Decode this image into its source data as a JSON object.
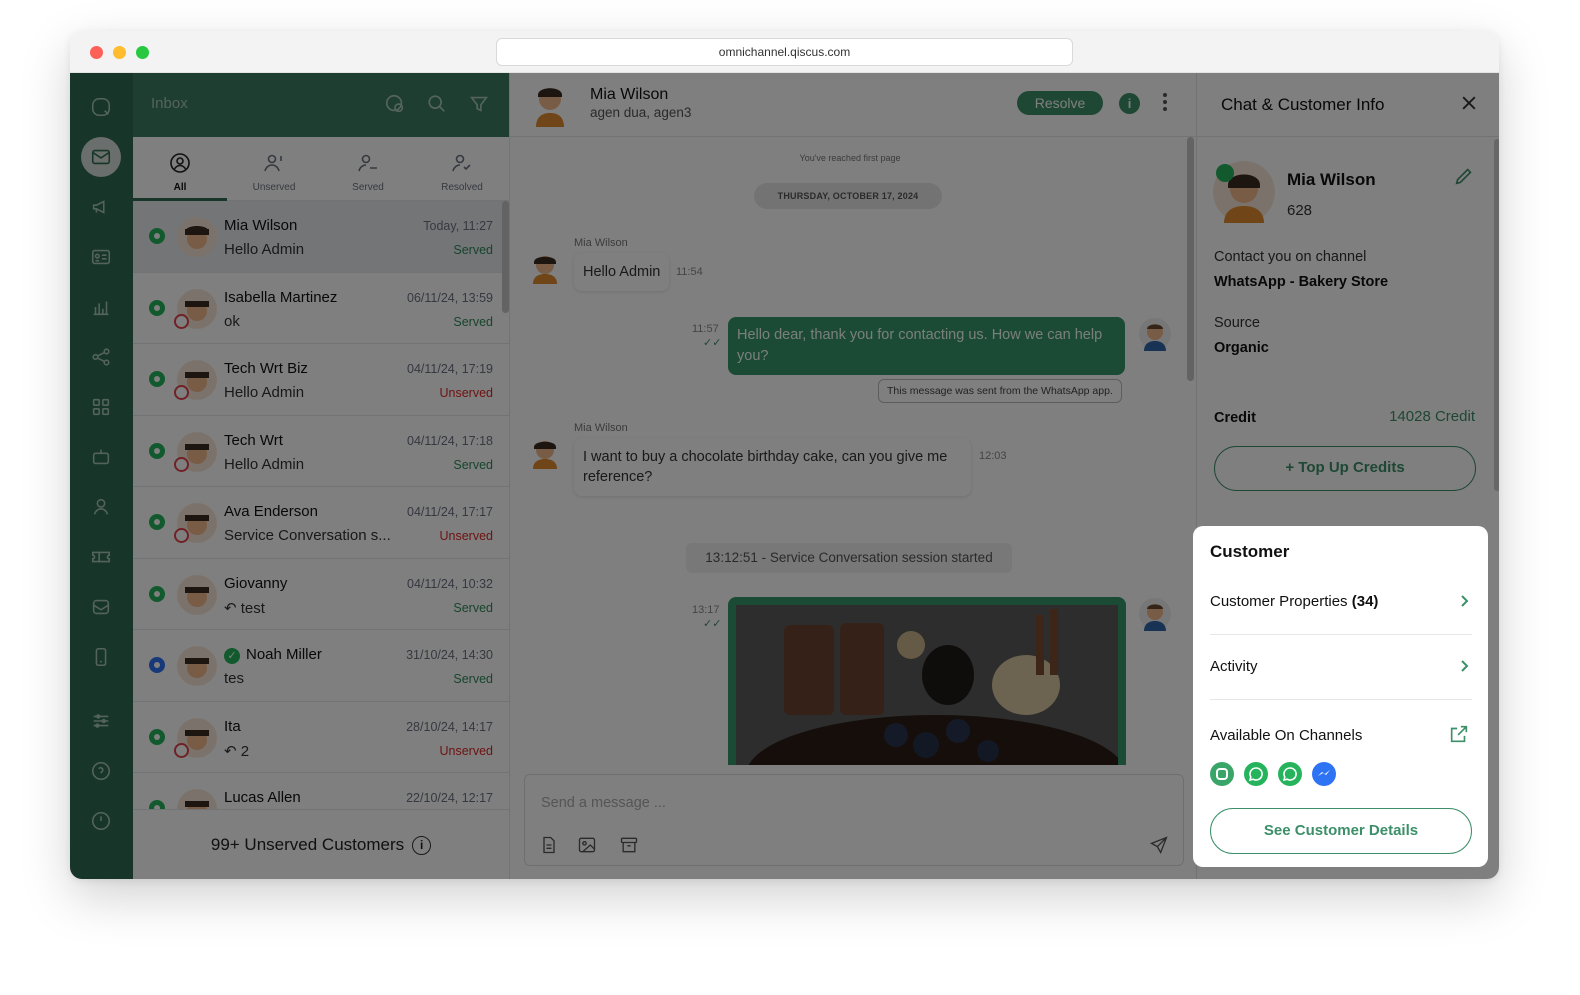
{
  "browser": {
    "url": "omnichannel.qiscus.com"
  },
  "inbox": {
    "title": "Inbox",
    "tabs": [
      {
        "label": "All"
      },
      {
        "label": "Unserved"
      },
      {
        "label": "Served"
      },
      {
        "label": "Resolved"
      }
    ],
    "rows": [
      {
        "name": "Mia Wilson",
        "message": "Hello Admin",
        "time": "Today, 11:27",
        "status": "Served",
        "channel": "whatsapp"
      },
      {
        "name": "Isabella Martinez",
        "message": "ok",
        "time": "06/11/24, 13:59",
        "status": "Served",
        "channel": "whatsapp"
      },
      {
        "name": "Tech Wrt Biz",
        "message": "Hello Admin",
        "time": "04/11/24, 17:19",
        "status": "Unserved",
        "channel": "whatsapp"
      },
      {
        "name": "Tech Wrt",
        "message": "Hello Admin",
        "time": "04/11/24, 17:18",
        "status": "Served",
        "channel": "whatsapp"
      },
      {
        "name": "Ava Enderson",
        "message": "Service Conversation s...",
        "time": "04/11/24, 17:17",
        "status": "Unserved",
        "channel": "whatsapp"
      },
      {
        "name": "Giovanny",
        "message": "test",
        "time": "04/11/24, 10:32",
        "status": "Served",
        "channel": "agent"
      },
      {
        "name": "Noah Miller",
        "message": "tes",
        "time": "31/10/24, 14:30",
        "status": "Served",
        "channel": "messenger"
      },
      {
        "name": "Ita",
        "message": "2",
        "time": "28/10/24, 14:17",
        "status": "Unserved",
        "channel": "whatsapp"
      },
      {
        "name": "Lucas Allen",
        "message": "",
        "time": "22/10/24, 12:17",
        "status": "",
        "channel": "whatsapp"
      }
    ],
    "footer": "99+ Unserved Customers"
  },
  "chat": {
    "name": "Mia Wilson",
    "agents": "agen dua, agen3",
    "resolve_label": "Resolve",
    "first_page": "You've reached first page",
    "date": "THURSDAY, OCTOBER 17, 2024",
    "messages": [
      {
        "sender": "Mia Wilson",
        "text": "Hello Admin",
        "time": "11:54"
      },
      {
        "text": "Hello dear, thank you for contacting us. How we can help you?",
        "time": "11:57",
        "note": "This message was sent from the WhatsApp app."
      },
      {
        "sender": "Mia Wilson",
        "text": "I want to buy a chocolate birthday cake, can you give me reference?",
        "time": "12:03"
      },
      {
        "session": "13:12:51 - Service Conversation session started"
      },
      {
        "time": "13:17",
        "image": "chocolate-cake-30"
      }
    ],
    "composer_placeholder": "Send a message ..."
  },
  "panel": {
    "title": "Chat & Customer Info",
    "customer_name": "Mia Wilson",
    "phone": "628",
    "contact_label": "Contact you on channel",
    "contact_value": "WhatsApp - Bakery Store",
    "source_label": "Source",
    "source_value": "Organic",
    "credit_label": "Credit",
    "credit_value": "14028 Credit",
    "topup_label": "+ Top Up Credits"
  },
  "card": {
    "title": "Customer",
    "properties_label": "Customer Properties",
    "properties_count": "(34)",
    "activity_label": "Activity",
    "available_label": "Available On Channels",
    "details_label": "See Customer Details",
    "channels": [
      "qiscus-chat-icon",
      "whatsapp-icon",
      "whatsapp-icon",
      "messenger-icon"
    ]
  },
  "colors": {
    "brand": "#2e6b52",
    "accent": "#3c8f69",
    "unserved": "#dc2626",
    "served": "#2e8b5a"
  }
}
